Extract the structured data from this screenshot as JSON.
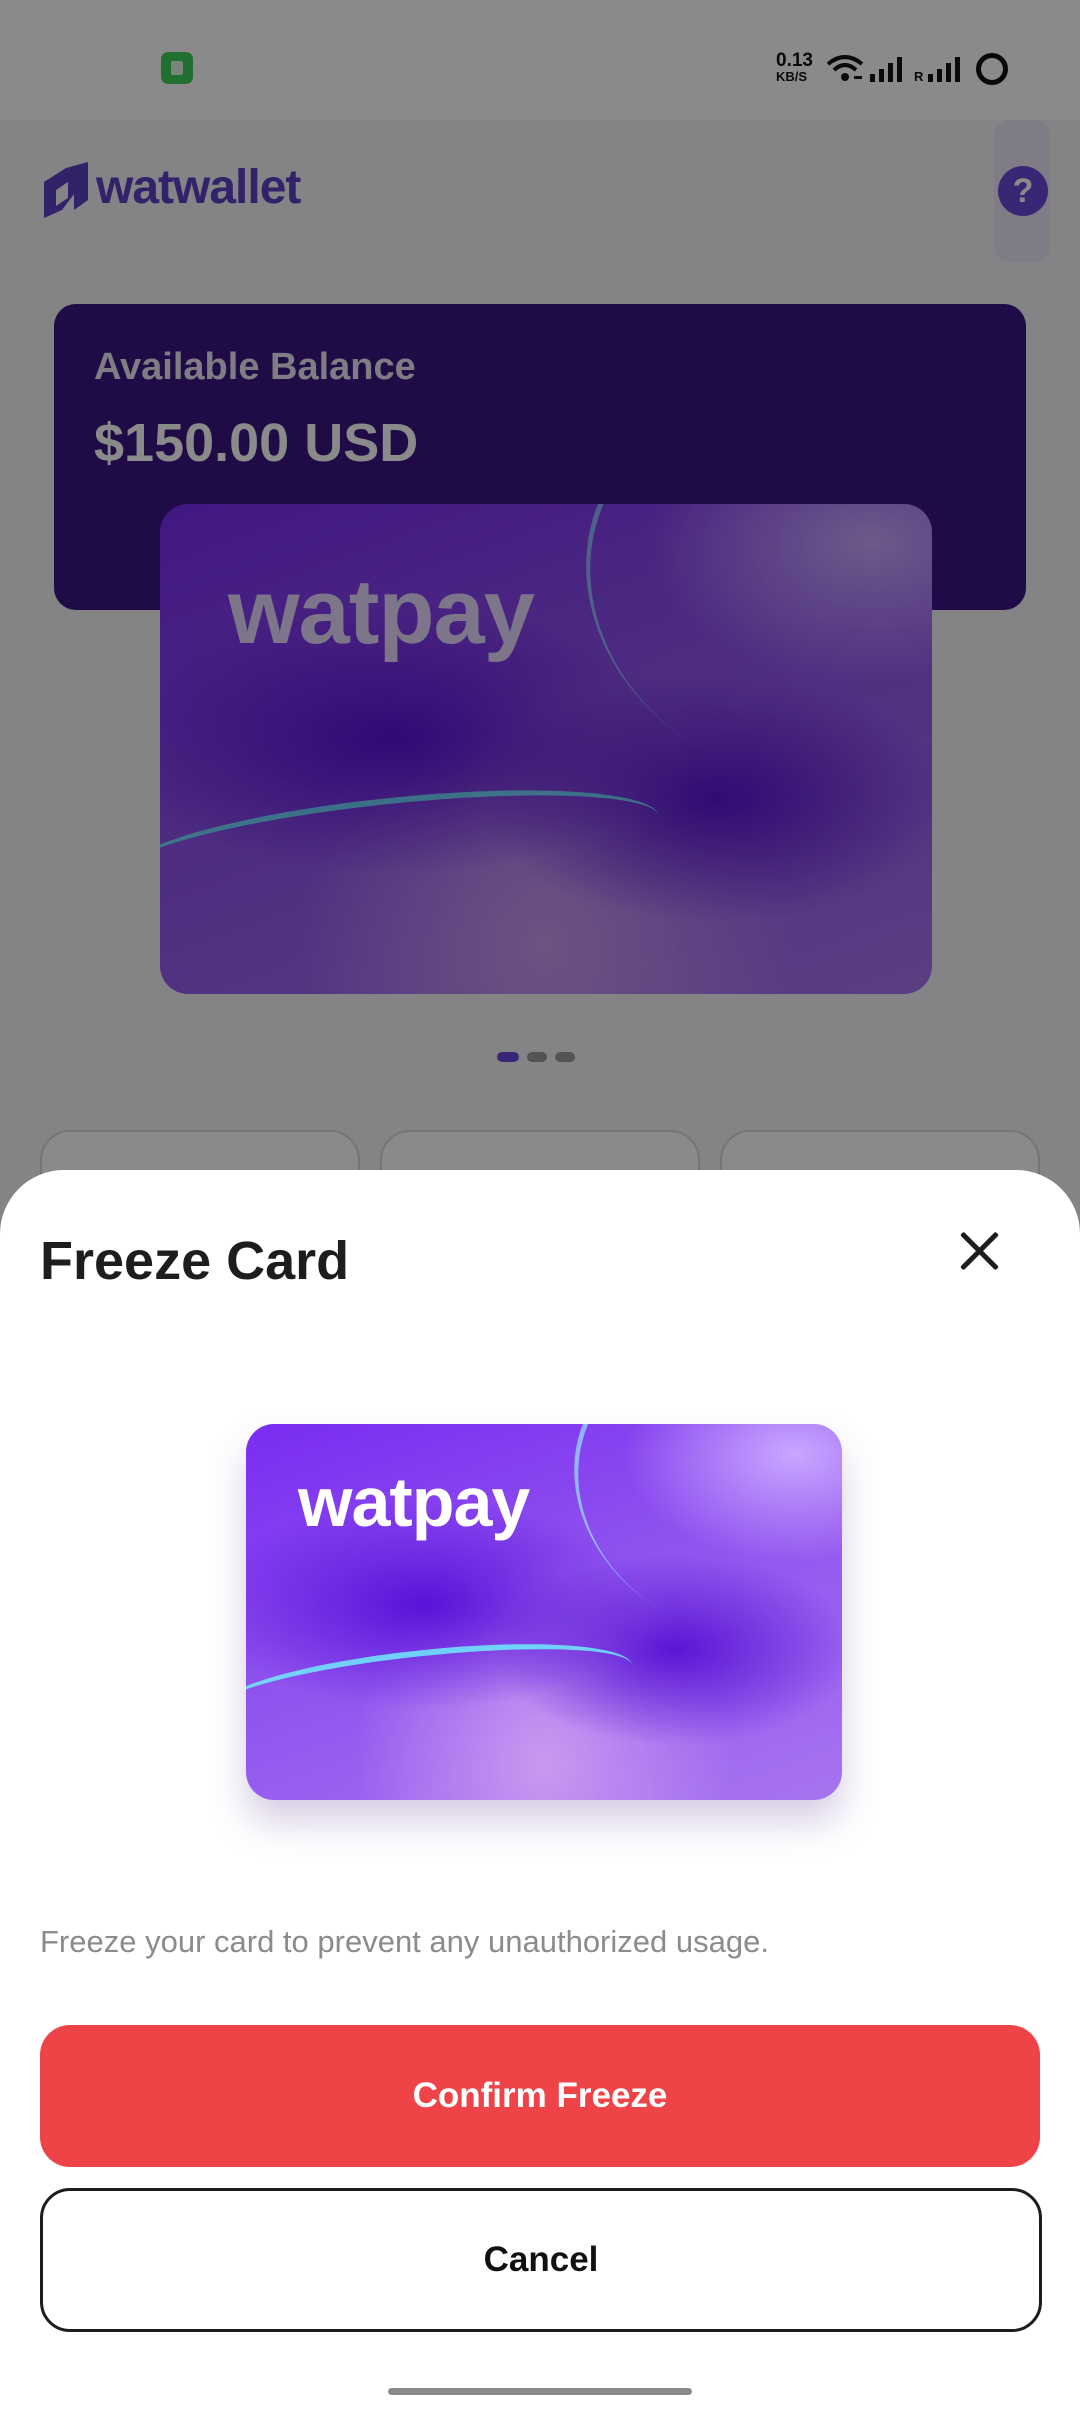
{
  "status_bar": {
    "network_speed_value": "0.13",
    "network_speed_unit": "KB/S",
    "roaming_indicator": "R",
    "icons": [
      "app-notification-icon",
      "wifi-icon",
      "cellular-signal-icon",
      "cellular-signal-2-icon",
      "battery-icon"
    ]
  },
  "header": {
    "logo_text": "watwallet",
    "help_label": "?"
  },
  "balance": {
    "label": "Available Balance",
    "value": "$150.00 USD"
  },
  "card": {
    "brand": "watpay"
  },
  "pager": {
    "count": 3,
    "active_index": 0
  },
  "sheet": {
    "title": "Freeze Card",
    "card_brand": "watpay",
    "description": "Freeze your card to prevent any unauthorized usage.",
    "confirm_label": "Confirm Freeze",
    "cancel_label": "Cancel"
  },
  "colors": {
    "brand_purple": "#5b3fc2",
    "balance_card": "#3a1680",
    "confirm_red": "#ef4447",
    "text_dark": "#1d1d1d",
    "text_muted": "#8b8b8b"
  }
}
